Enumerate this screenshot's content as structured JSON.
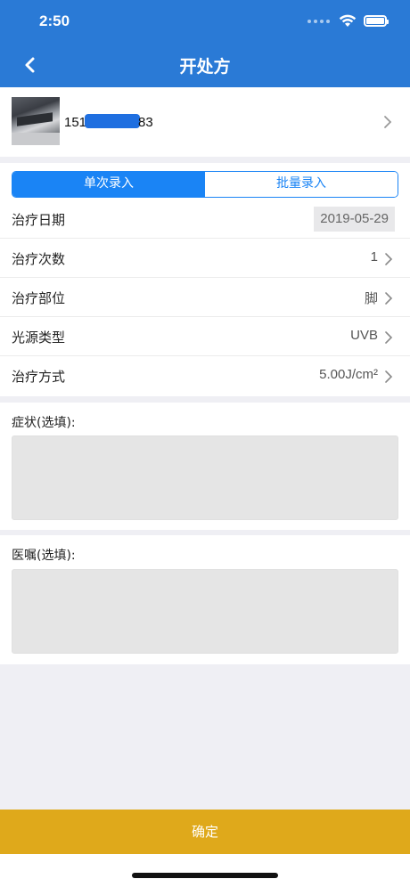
{
  "status_bar": {
    "time": "2:50"
  },
  "nav": {
    "title": "开处方"
  },
  "patient": {
    "phone_prefix": "151",
    "phone_suffix": "83"
  },
  "segment": {
    "tabs": [
      {
        "label": "单次录入",
        "active": true
      },
      {
        "label": "批量录入",
        "active": false
      }
    ]
  },
  "form": {
    "rows": [
      {
        "label": "治疗日期",
        "value": "2019-05-29"
      },
      {
        "label": "治疗次数",
        "value": "1"
      },
      {
        "label": "治疗部位",
        "value": "脚"
      },
      {
        "label": "光源类型",
        "value": "UVB"
      },
      {
        "label": "治疗方式",
        "value": "5.00J/cm²"
      }
    ]
  },
  "symptoms": {
    "label": "症状(选填):",
    "value": ""
  },
  "advice": {
    "label": "医嘱(选填):",
    "value": ""
  },
  "actions": {
    "confirm_label": "确定"
  },
  "colors": {
    "header": "#2a7ad6",
    "segment_active": "#1a84f5",
    "confirm": "#dfa91b"
  }
}
